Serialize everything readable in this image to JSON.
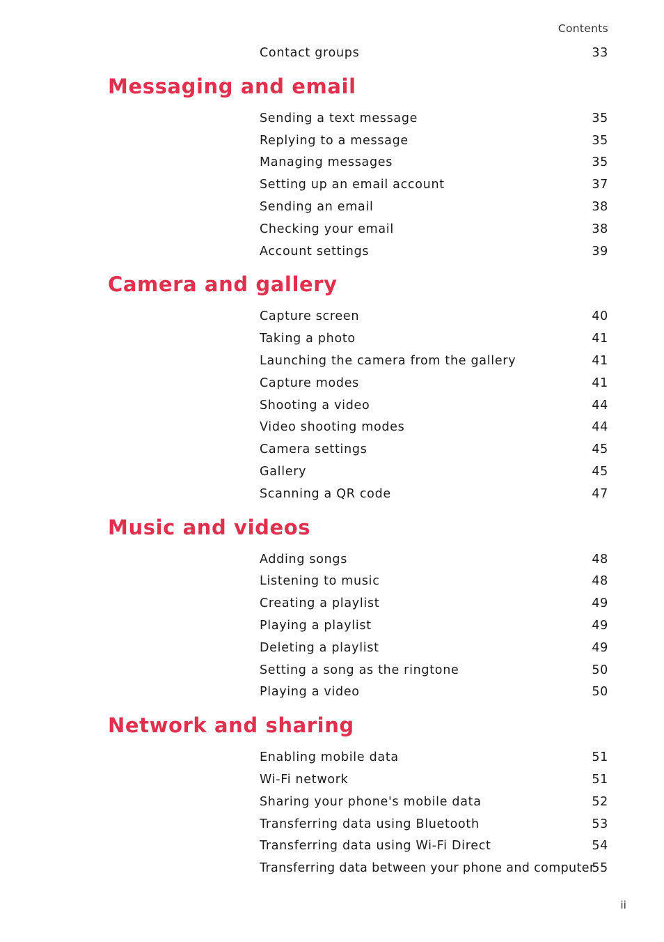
{
  "header": {
    "running_title": "Contents"
  },
  "colors": {
    "heading": "#e0304e",
    "text": "#1a1a1a"
  },
  "continued_entries": [
    {
      "title": "Contact groups",
      "page": "33"
    }
  ],
  "sections": [
    {
      "heading": "Messaging and email",
      "entries": [
        {
          "title": "Sending a text message",
          "page": "35"
        },
        {
          "title": "Replying to a message",
          "page": "35"
        },
        {
          "title": "Managing messages",
          "page": "35"
        },
        {
          "title": "Setting up an email account",
          "page": "37"
        },
        {
          "title": "Sending an email",
          "page": "38"
        },
        {
          "title": "Checking your email",
          "page": "38"
        },
        {
          "title": "Account settings",
          "page": "39"
        }
      ]
    },
    {
      "heading": "Camera and gallery",
      "entries": [
        {
          "title": "Capture screen",
          "page": "40"
        },
        {
          "title": "Taking a photo",
          "page": "41"
        },
        {
          "title": "Launching the camera from the gallery",
          "page": "41"
        },
        {
          "title": "Capture modes",
          "page": "41"
        },
        {
          "title": "Shooting a video",
          "page": "44"
        },
        {
          "title": "Video shooting modes",
          "page": "44"
        },
        {
          "title": "Camera settings",
          "page": "45"
        },
        {
          "title": "Gallery",
          "page": "45"
        },
        {
          "title": "Scanning a QR code",
          "page": "47"
        }
      ]
    },
    {
      "heading": "Music and videos",
      "entries": [
        {
          "title": "Adding songs",
          "page": "48"
        },
        {
          "title": "Listening to music",
          "page": "48"
        },
        {
          "title": "Creating a playlist",
          "page": "49"
        },
        {
          "title": "Playing a playlist",
          "page": "49"
        },
        {
          "title": "Deleting a playlist",
          "page": "49"
        },
        {
          "title": "Setting a song as the ringtone",
          "page": "50"
        },
        {
          "title": "Playing a video",
          "page": "50"
        }
      ]
    },
    {
      "heading": "Network and sharing",
      "entries": [
        {
          "title": "Enabling mobile data",
          "page": "51"
        },
        {
          "title": "Wi-Fi network",
          "page": "51"
        },
        {
          "title": "Sharing your phone's mobile data",
          "page": "52"
        },
        {
          "title": "Transferring data using Bluetooth",
          "page": "53"
        },
        {
          "title": "Transferring data using Wi-Fi Direct",
          "page": "54"
        },
        {
          "title": "Transferring data between your phone and computer",
          "page": "55"
        }
      ]
    }
  ],
  "footer": {
    "page_number": "ii"
  }
}
